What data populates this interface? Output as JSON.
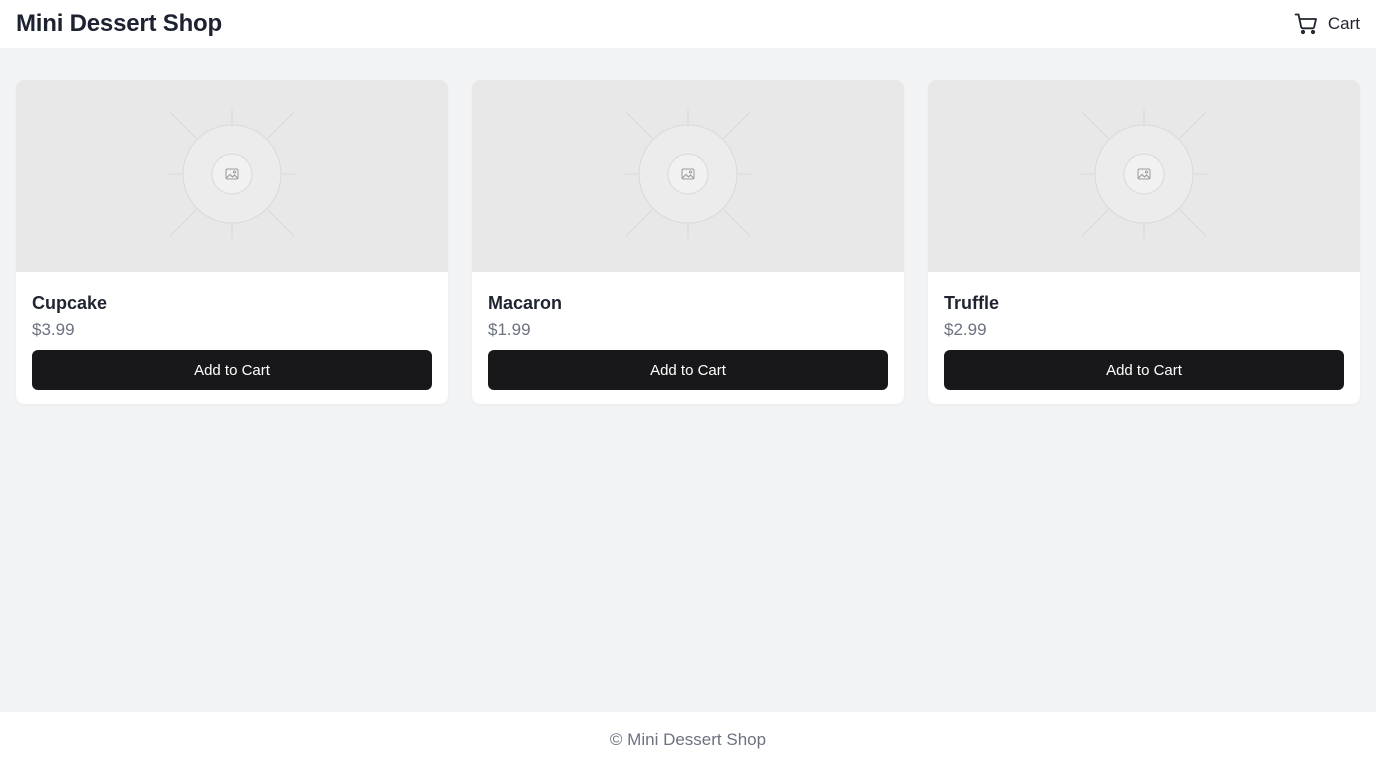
{
  "header": {
    "title": "Mini Dessert Shop",
    "cart_label": "Cart",
    "cart_icon": "shopping-cart-icon"
  },
  "products": [
    {
      "name": "Cupcake",
      "price": "$3.99",
      "button_label": "Add to Cart",
      "image_icon": "image-placeholder-icon"
    },
    {
      "name": "Macaron",
      "price": "$1.99",
      "button_label": "Add to Cart",
      "image_icon": "image-placeholder-icon"
    },
    {
      "name": "Truffle",
      "price": "$2.99",
      "button_label": "Add to Cart",
      "image_icon": "image-placeholder-icon"
    }
  ],
  "footer": {
    "text": "© Mini Dessert Shop"
  },
  "colors": {
    "page_background": "#f2f3f5",
    "surface": "#ffffff",
    "button": "#18181b",
    "muted_text": "#6b7280"
  }
}
